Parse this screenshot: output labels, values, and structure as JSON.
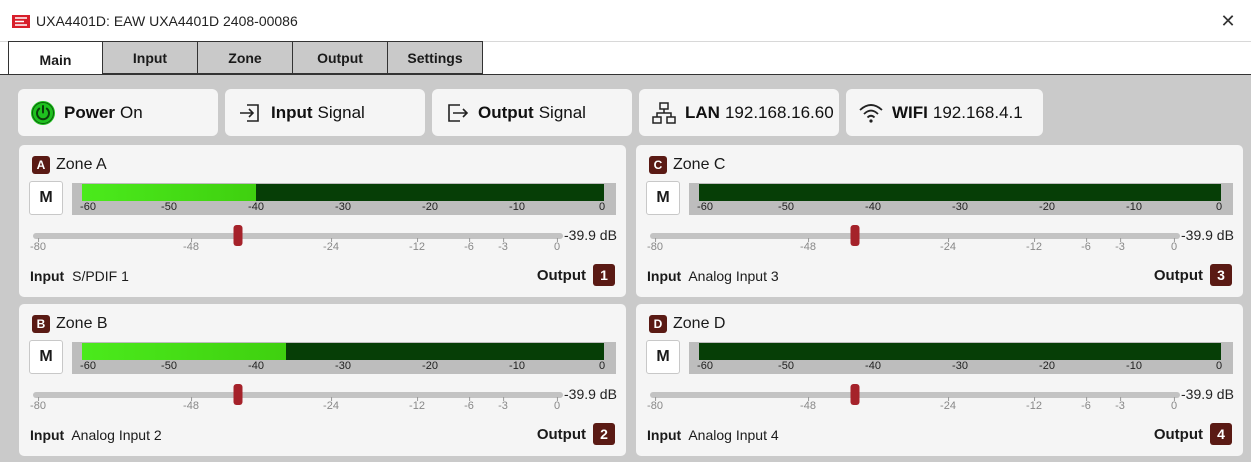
{
  "window": {
    "title": "UXA4401D: EAW UXA4401D 2408-00086",
    "close_glyph": "✕"
  },
  "tabs": [
    {
      "label": "Main",
      "active": true
    },
    {
      "label": "Input",
      "active": false
    },
    {
      "label": "Zone",
      "active": false
    },
    {
      "label": "Output",
      "active": false
    },
    {
      "label": "Settings",
      "active": false
    }
  ],
  "status": {
    "power": {
      "label": "Power",
      "value": "On",
      "icon": "power-icon",
      "color": "#1fc11f"
    },
    "input": {
      "label": "Input",
      "value": "Signal",
      "icon": "input-arrow-icon"
    },
    "output": {
      "label": "Output",
      "value": "Signal",
      "icon": "output-arrow-icon"
    },
    "lan": {
      "label": "LAN",
      "value": "192.168.16.60",
      "icon": "network-icon"
    },
    "wifi": {
      "label": "WIFI",
      "value": "192.168.4.1",
      "icon": "wifi-icon"
    }
  },
  "meter_scale": [
    "-60",
    "-50",
    "-40",
    "-30",
    "-20",
    "-10",
    "0"
  ],
  "slider_scale": [
    "-80",
    "-48",
    "-24",
    "-12",
    "-6",
    "-3",
    "0"
  ],
  "labels": {
    "mute": "M",
    "input": "Input",
    "output": "Output"
  },
  "zones": [
    {
      "letter": "A",
      "name": "Zone A",
      "level_db": -40.0,
      "gain_db": -39.9,
      "gain_text": "-39.9 dB",
      "input": "S/PDIF 1",
      "output": "1"
    },
    {
      "letter": "B",
      "name": "Zone B",
      "level_db": -36.5,
      "gain_db": -39.9,
      "gain_text": "-39.9 dB",
      "input": "Analog Input 2",
      "output": "2"
    },
    {
      "letter": "C",
      "name": "Zone C",
      "level_db": -60.0,
      "gain_db": -39.9,
      "gain_text": "-39.9 dB",
      "input": "Analog Input 3",
      "output": "3"
    },
    {
      "letter": "D",
      "name": "Zone D",
      "level_db": -60.0,
      "gain_db": -39.9,
      "gain_text": "-39.9 dB",
      "input": "Analog Input 4",
      "output": "4"
    }
  ],
  "colors": {
    "accent": "#5a1a14",
    "slider_thumb": "#a5222a",
    "meter_bg": "#063e06",
    "meter_fill": "#4bea1c",
    "logo": "#d81e2a"
  }
}
